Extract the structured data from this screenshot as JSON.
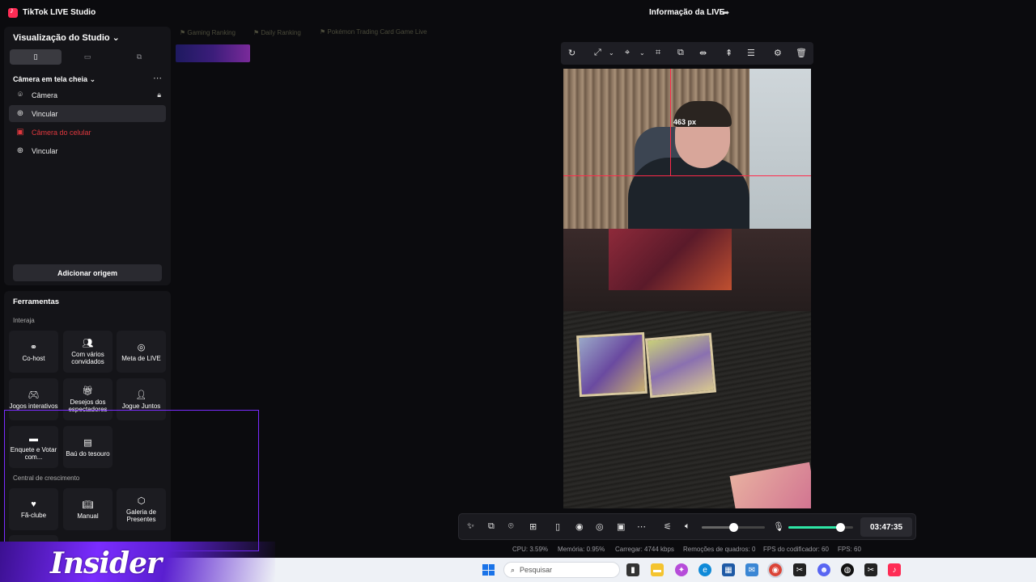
{
  "app": {
    "title": "TikTok LIVE Studio",
    "live_info": "Informação da LIVE"
  },
  "studio": {
    "title": "Visualização do Studio",
    "scene": "Câmera em tela cheia",
    "sources": [
      {
        "label": "Câmera",
        "icon": "camera-icon",
        "locked": true
      },
      {
        "label": "Vincular",
        "icon": "globe-icon",
        "active": true
      },
      {
        "label": "Câmera do celular",
        "icon": "phone-camera-icon",
        "error": true
      },
      {
        "label": "Vincular",
        "icon": "globe-icon"
      }
    ],
    "add_source": "Adicionar origem"
  },
  "tools": {
    "title": "Ferramentas",
    "section_interact": "Interaja",
    "section_growth": "Central de crescimento",
    "interact": [
      {
        "label": "Co-host",
        "icon": "link-icon"
      },
      {
        "label": "Com vários convidados",
        "icon": "users-icon"
      },
      {
        "label": "Meta de LIVE",
        "icon": "target-icon"
      },
      {
        "label": "Jogos interativos",
        "icon": "gamepad-icon"
      },
      {
        "label": "Desejos dos espectadores",
        "icon": "gift-icon"
      },
      {
        "label": "Jogue Juntos",
        "icon": "person-icon"
      },
      {
        "label": "Enquete e Votar com...",
        "icon": "poll-icon"
      },
      {
        "label": "Baú do tesouro",
        "icon": "chest-icon"
      }
    ],
    "growth": [
      {
        "label": "Fã-clube",
        "icon": "heart-icon"
      },
      {
        "label": "Manual",
        "icon": "book-icon"
      },
      {
        "label": "Galeria de Presentes",
        "icon": "gallery-icon"
      }
    ]
  },
  "rankings": [
    "Gaming Ranking",
    "Daily Ranking",
    "Pokémon Trading Card Game Live"
  ],
  "preview": {
    "measure_label": "463 px"
  },
  "controls": {
    "timer": "03:47:35",
    "volume_level": 0.5,
    "mic_level": 0.8
  },
  "stats": {
    "cpu": "CPU:  3.59%",
    "memory": "Memória:  0.95%",
    "upload": "Carregar:  4744 kbps",
    "dropped": "Remoções de quadros:  0",
    "encoder_fps": "FPS do codificador:  60",
    "fps": "FPS:  60"
  },
  "taskbar": {
    "search_placeholder": "Pesquisar"
  },
  "overlay": {
    "brand": "Insider"
  },
  "colors": {
    "accent": "#fe2c55",
    "error": "#e0383e",
    "mic": "#2ee6a6",
    "overlay": "#7a2cff"
  }
}
